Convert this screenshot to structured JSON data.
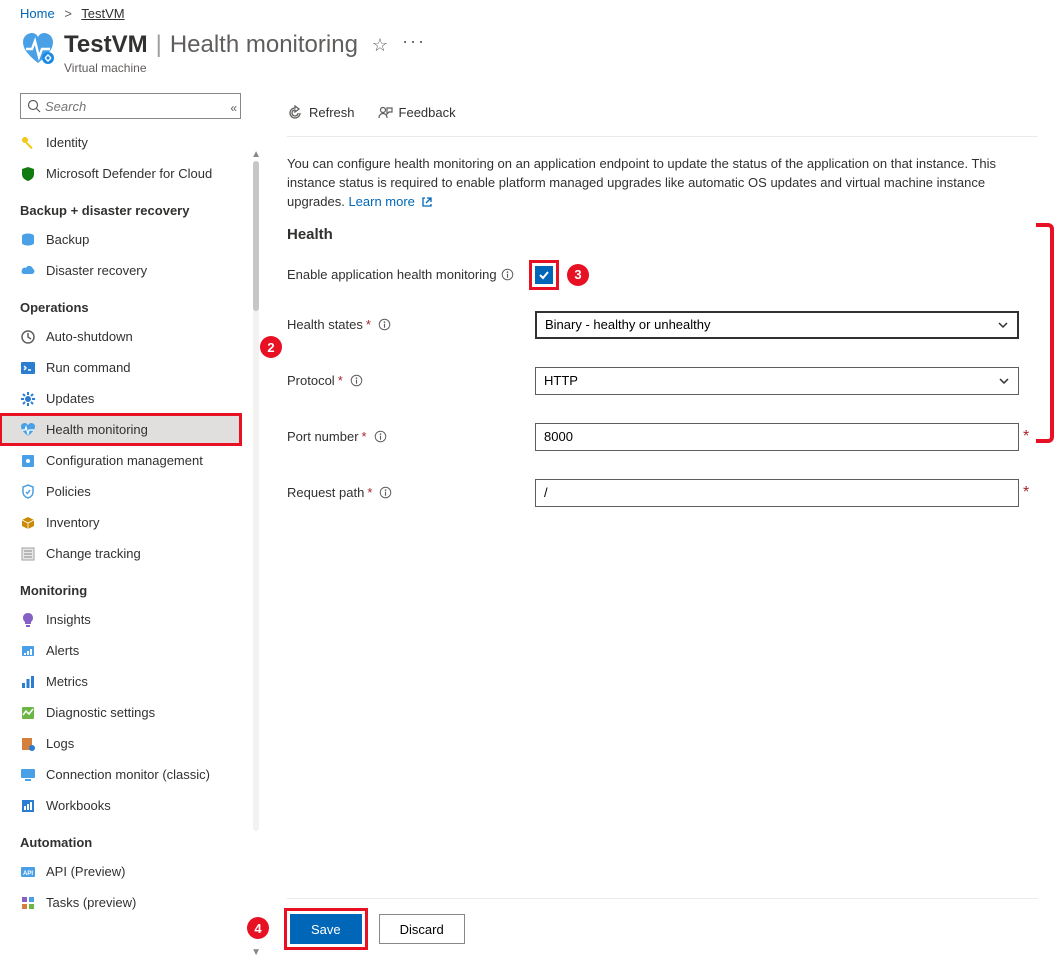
{
  "breadcrumb": {
    "home": "Home",
    "current": "TestVM"
  },
  "header": {
    "title": "TestVM",
    "subtitle": "Health monitoring",
    "resource_type": "Virtual machine"
  },
  "search": {
    "placeholder": "Search"
  },
  "sidebar": {
    "items": {
      "identity": "Identity",
      "defender": "Microsoft Defender for Cloud",
      "section_backup": "Backup + disaster recovery",
      "backup": "Backup",
      "disaster_recovery": "Disaster recovery",
      "section_ops": "Operations",
      "auto_shutdown": "Auto-shutdown",
      "run_command": "Run command",
      "updates": "Updates",
      "health_monitoring": "Health monitoring",
      "config_mgmt": "Configuration management",
      "policies": "Policies",
      "inventory": "Inventory",
      "change_tracking": "Change tracking",
      "section_monitoring": "Monitoring",
      "insights": "Insights",
      "alerts": "Alerts",
      "metrics": "Metrics",
      "diag": "Diagnostic settings",
      "logs": "Logs",
      "conn_mon": "Connection monitor (classic)",
      "workbooks": "Workbooks",
      "section_automation": "Automation",
      "api_preview": "API (Preview)",
      "tasks_preview": "Tasks (preview)"
    }
  },
  "toolbar": {
    "refresh": "Refresh",
    "feedback": "Feedback"
  },
  "main": {
    "description": "You can configure health monitoring on an application endpoint to update the status of the application on that instance. This instance status is required to enable platform managed upgrades like automatic OS updates and virtual machine instance upgrades. ",
    "learn_more": "Learn more",
    "section_health": "Health",
    "enable_label": "Enable application health monitoring",
    "health_states_label": "Health states",
    "health_states_value": "Binary - healthy or unhealthy",
    "protocol_label": "Protocol",
    "protocol_value": "HTTP",
    "port_label": "Port number",
    "port_value": "8000",
    "request_path_label": "Request path",
    "request_path_value": "/"
  },
  "footer": {
    "save": "Save",
    "discard": "Discard"
  },
  "callouts": {
    "c2": "2",
    "c3": "3",
    "c4": "4"
  }
}
